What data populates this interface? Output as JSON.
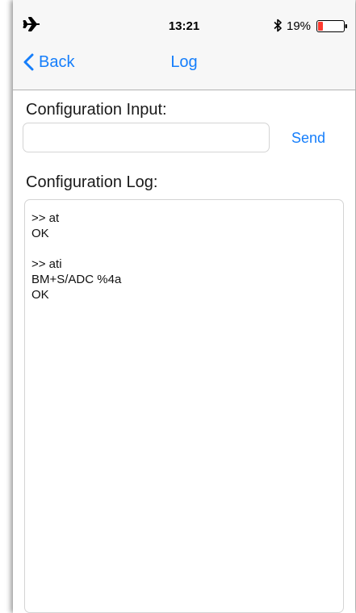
{
  "status_bar": {
    "time": "13:21",
    "battery_percent": "19%",
    "battery_level": 0.19,
    "airplane_icon": "airplane-icon",
    "bluetooth_icon": "bluetooth-icon",
    "battery_icon": "battery-icon"
  },
  "nav": {
    "back_label": "Back",
    "title": "Log"
  },
  "config_input": {
    "label": "Configuration Input:",
    "value": "",
    "placeholder": "",
    "send_label": "Send"
  },
  "config_log": {
    "label": "Configuration Log:",
    "lines": [
      ">> at",
      "OK",
      "",
      ">> ati",
      "BM+S/ADC %4a",
      "OK"
    ]
  },
  "colors": {
    "accent": "#157efb",
    "battery_low": "#ff3b30",
    "nav_background": "#f7f7f7"
  }
}
